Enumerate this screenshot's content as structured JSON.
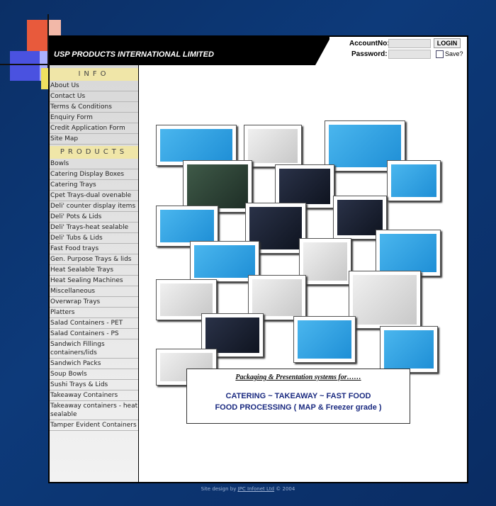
{
  "company": {
    "name": "USP PRODUCTS INTERNATIONAL LIMITED"
  },
  "login": {
    "account_label": "AccountNo:",
    "password_label": "Password:",
    "account_value": "",
    "password_value": "",
    "login_button": "LOGIN",
    "save_label": "Save?"
  },
  "info": {
    "heading": "INFO",
    "items": [
      "About Us",
      "Contact Us",
      "Terms & Conditions",
      "Enquiry Form",
      "Credit Application Form",
      "Site Map"
    ]
  },
  "products": {
    "heading": "PRODUCTS",
    "items": [
      "Bowls",
      "Catering Display Boxes",
      "Catering Trays",
      "Cpet Trays-dual ovenable",
      "Deli' counter display items",
      "Deli' Pots & Lids",
      "Deli' Trays-heat sealable",
      "Deli' Tubs & Lids",
      "Fast Food trays",
      "Gen. Purpose Trays & lids",
      "Heat Sealable Trays",
      "Heat Sealing Machines",
      "Miscellaneous",
      "Overwrap Trays",
      "Platters",
      "Salad Containers - PET",
      "Salad Containers - PS",
      "Sandwich Fillings containers/lids",
      "Sandwich Packs",
      "Soup Bowls",
      "Sushi Trays & Lids",
      "Takeaway Containers",
      "Takeaway containers - heat sealable",
      "Tamper Evident Containers"
    ]
  },
  "tagline": {
    "line1": "Packaging & Presentation systems for……",
    "line2": "CATERING ~ TAKEAWAY ~ FAST FOOD",
    "line3": "FOOD PROCESSING  ( MAP & Freezer grade )"
  },
  "footer": {
    "prefix": "Site design by ",
    "link": "JPC Infonet Ltd",
    "suffix": " © 2004"
  }
}
